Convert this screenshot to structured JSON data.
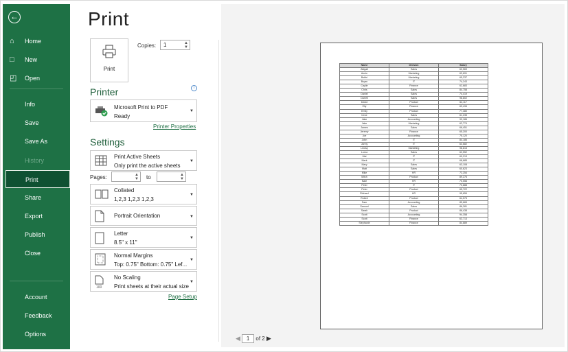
{
  "sidebar": {
    "items": [
      {
        "label": "Home",
        "icon": "home-icon"
      },
      {
        "label": "New",
        "icon": "new-document-icon"
      },
      {
        "label": "Open",
        "icon": "open-folder-icon"
      },
      {
        "label": "Info"
      },
      {
        "label": "Save"
      },
      {
        "label": "Save As"
      },
      {
        "label": "History"
      },
      {
        "label": "Print"
      },
      {
        "label": "Share"
      },
      {
        "label": "Export"
      },
      {
        "label": "Publish"
      },
      {
        "label": "Close"
      },
      {
        "label": "Account"
      },
      {
        "label": "Feedback"
      },
      {
        "label": "Options"
      }
    ],
    "colors": {
      "background": "#1e7145",
      "active": "#0f5132"
    }
  },
  "page": {
    "title": "Print"
  },
  "print_button": {
    "label": "Print"
  },
  "copies": {
    "label": "Copies:",
    "value": "1"
  },
  "printer": {
    "section_title": "Printer",
    "name": "Microsoft Print to PDF",
    "status": "Ready",
    "properties_link": "Printer Properties"
  },
  "settings": {
    "section_title": "Settings",
    "what": {
      "line1": "Print Active Sheets",
      "line2": "Only print the active sheets"
    },
    "pages_label": "Pages:",
    "to_label": "to",
    "collate": {
      "line1": "Collated",
      "line2": "1,2,3   1,2,3   1,2,3"
    },
    "orientation": {
      "line1": "Portrait Orientation"
    },
    "paper": {
      "line1": "Letter",
      "line2": "8.5\" x 11\""
    },
    "margins": {
      "line1": "Normal Margins",
      "line2": "Top: 0.75\" Bottom: 0.75\" Lef..."
    },
    "scaling": {
      "line1": "No Scaling",
      "line2": "Print sheets at their actual size"
    },
    "page_setup_link": "Page Setup"
  },
  "preview": {
    "headers": [
      "Name",
      "Division",
      "Salary"
    ],
    "rows": [
      [
        "Abigail",
        "Sales",
        "60,569"
      ],
      [
        "Annie",
        "Marketing",
        "63,691"
      ],
      [
        "Bobbi",
        "Marketing",
        "65,237"
      ],
      [
        "Bryan",
        "IT",
        "74,243"
      ],
      [
        "Caylie",
        "Finance",
        "62,683"
      ],
      [
        "Chris",
        "Sales",
        "84,758"
      ],
      [
        "Daniel",
        "Sales",
        "74,419"
      ],
      [
        "Darrell",
        "Sales",
        "98,802"
      ],
      [
        "David",
        "Product",
        "64,117"
      ],
      [
        "Elly",
        "Finance",
        "63,434"
      ],
      [
        "Emily",
        "Product",
        "77,380"
      ],
      [
        "Irene",
        "Sales",
        "61,235"
      ],
      [
        "Jake",
        "Accounting",
        "99,186"
      ],
      [
        "Jake",
        "Marketing",
        "62,774"
      ],
      [
        "James",
        "Sales",
        "66,451"
      ],
      [
        "Jeremy",
        "Finance",
        "65,200"
      ],
      [
        "Joe",
        "Accounting",
        "75,120"
      ],
      [
        "John",
        "IT",
        "84,186"
      ],
      [
        "Jonny",
        "IT",
        "63,682"
      ],
      [
        "Lindsy",
        "Marketing",
        "98,815"
      ],
      [
        "Lorna",
        "Sales",
        "62,552"
      ],
      [
        "Mai",
        "IT",
        "69,213"
      ],
      [
        "Mark",
        "IT",
        "68,685"
      ],
      [
        "Mary",
        "Sales",
        "63,108"
      ],
      [
        "Matt",
        "Sales",
        "60,623"
      ],
      [
        "Mike",
        "HR",
        "72,254"
      ],
      [
        "Mitch",
        "Product",
        "89,276"
      ],
      [
        "Nate",
        "HR",
        "70,556"
      ],
      [
        "Peter",
        "IT",
        "70,888"
      ],
      [
        "Peter",
        "Product",
        "65,722"
      ],
      [
        "Richard",
        "HR",
        "95,659"
      ],
      [
        "Robert",
        "Product",
        "64,575"
      ],
      [
        "Sam",
        "Accounting",
        "85,665"
      ],
      [
        "Samuel",
        "Sales",
        "86,281"
      ],
      [
        "Sarah",
        "Product",
        "86,438"
      ],
      [
        "Scott",
        "Accounting",
        "94,358"
      ],
      [
        "Scott",
        "Finance",
        "63,713"
      ],
      [
        "Stephanie",
        "Finance",
        "84,889"
      ]
    ]
  },
  "pager": {
    "current": "1",
    "of_label": "of 2"
  }
}
